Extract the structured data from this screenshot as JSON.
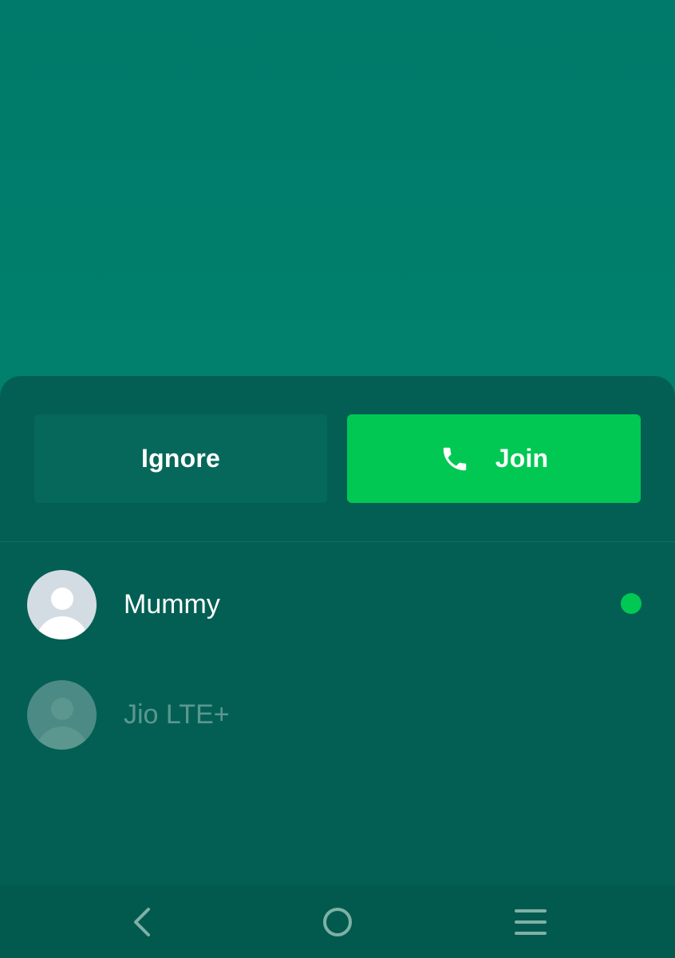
{
  "call_sheet": {
    "ignore_label": "Ignore",
    "join_label": "Join",
    "join_icon": "phone-icon"
  },
  "participants": [
    {
      "name": "Mummy",
      "status": "online",
      "status_color": "#00c853"
    },
    {
      "name": "Jio LTE+",
      "status": "inactive"
    }
  ],
  "navigation": {
    "back_icon": "back-icon",
    "home_icon": "home-icon",
    "menu_icon": "menu-icon"
  },
  "colors": {
    "background": "#007a6a",
    "sheet": "#035f53",
    "join_green": "#00c853",
    "ignore_button": "#06685b"
  }
}
